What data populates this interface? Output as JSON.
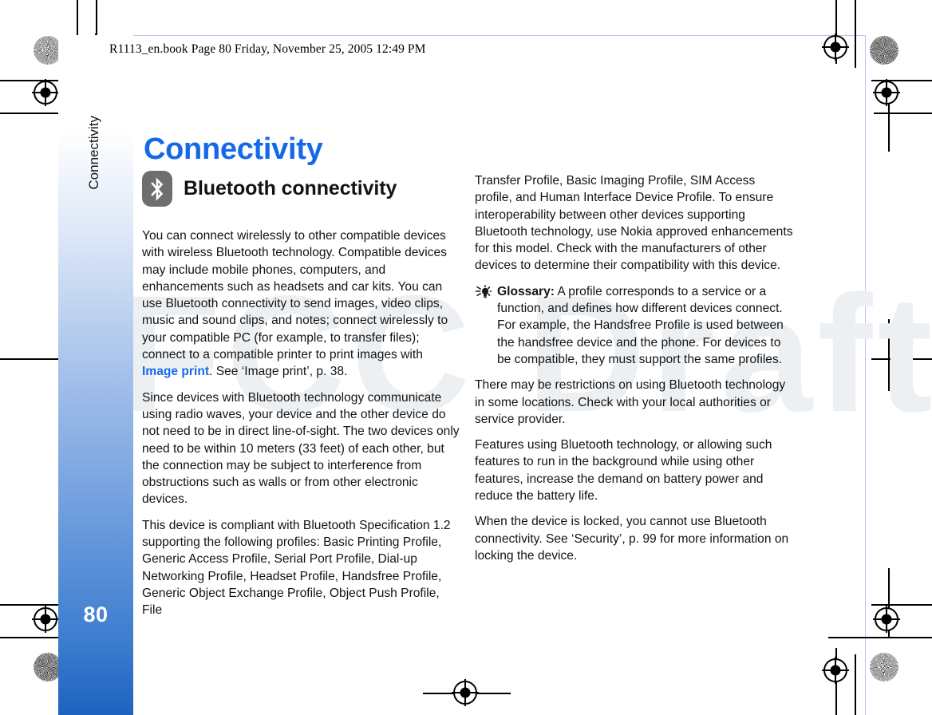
{
  "document": {
    "header_line": "R1113_en.book  Page 80  Friday, November 25, 2005  12:49 PM",
    "page_number": "80",
    "watermark": "FCC Draft",
    "sidebar_tab_label": "Connectivity",
    "chapter_title": "Connectivity"
  },
  "section": {
    "icon": "bluetooth-icon",
    "heading": "Bluetooth connectivity"
  },
  "colors": {
    "accent_blue": "#1569e8",
    "sidebar_blue": "#1f63c0",
    "icon_gray": "#6e6e6e",
    "watermark_gray": "#edf0f3",
    "body_text": "#131313"
  },
  "left_column": {
    "paragraphs": [
      {
        "id": "intro",
        "before_term": "You can connect wirelessly to other compatible devices with wireless Bluetooth technology. Compatible devices may include mobile phones, computers, and enhancements such as headsets and car kits. You can use Bluetooth connectivity to send images, video clips, music and sound clips, and notes; connect wirelessly to your compatible PC (for example, to transfer files); connect to a compatible printer to print images with ",
        "term": "Image print",
        "after_term": ". See ‘Image print’, p. 38."
      },
      {
        "id": "radio-waves",
        "text": "Since devices with Bluetooth technology communicate using radio waves, your device and the other device do not need to be in direct line-of-sight. The two devices only need to be within 10 meters (33 feet) of each other, but the connection may be subject to interference from obstructions such as walls or from other electronic devices."
      },
      {
        "id": "profiles",
        "text": "This device is compliant with Bluetooth Specification 1.2 supporting the following profiles: Basic Printing Profile, Generic Access Profile, Serial Port Profile, Dial-up Networking Profile, Headset Profile, Handsfree Profile, Generic Object Exchange Profile, Object Push Profile, File"
      }
    ]
  },
  "right_column": {
    "paragraph_continuation": "Transfer Profile, Basic Imaging Profile, SIM Access profile, and Human Interface Device Profile. To ensure interoperability between other devices supporting Bluetooth technology, use Nokia approved enhancements for this model. Check with the manufacturers of other devices to determine their compatibility with this device.",
    "glossary_note": {
      "icon": "tip-lightbulb-icon",
      "label": "Glossary:",
      "text": " A profile corresponds to a service or a function, and defines how different devices connect. For example, the Handsfree Profile is used between the handsfree device and the phone. For devices to be compatible, they must support the same profiles."
    },
    "paragraphs": [
      {
        "id": "restrictions",
        "text": "There may be restrictions on using Bluetooth technology in some locations. Check with your local authorities or service provider."
      },
      {
        "id": "battery",
        "text": "Features using Bluetooth technology, or allowing such features to run in the background while using other features, increase the demand on battery power and reduce the battery life."
      },
      {
        "id": "locked",
        "text": "When the device is locked, you cannot use Bluetooth connectivity. See ‘Security’, p. 99 for more information on locking the device."
      }
    ]
  }
}
